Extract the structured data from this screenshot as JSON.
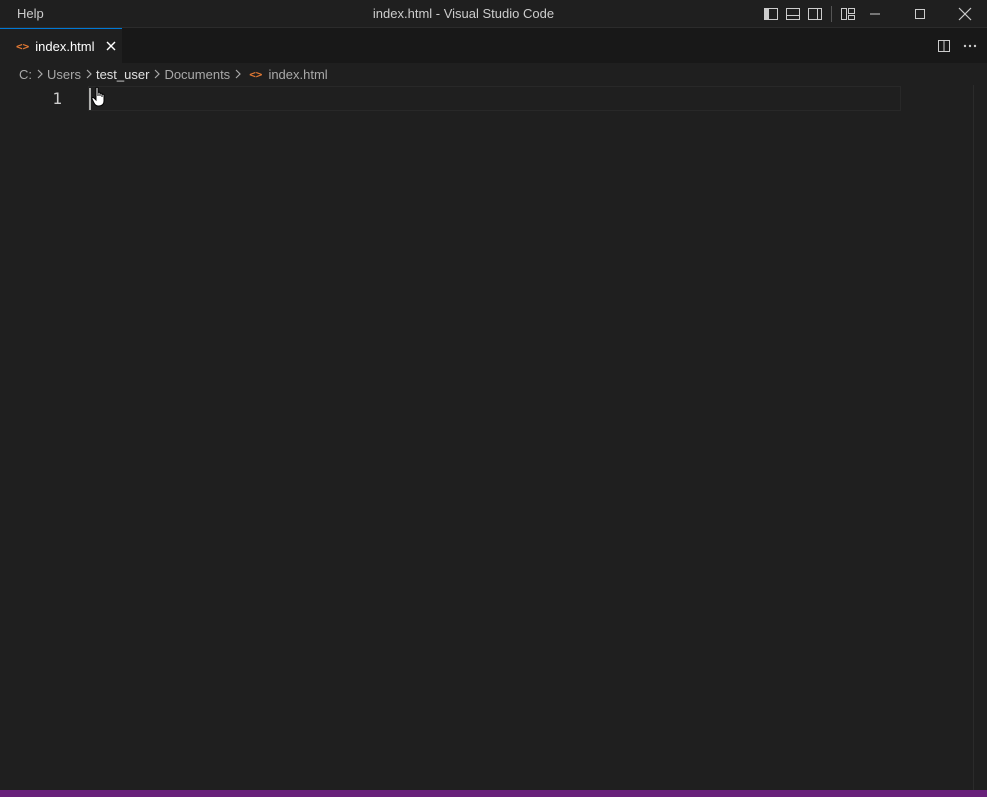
{
  "titlebar": {
    "menu_help": "Help",
    "window_title": "index.html - Visual Studio Code",
    "layout_icons": [
      "toggle-primary-sidebar-icon",
      "toggle-panel-icon",
      "toggle-secondary-sidebar-icon",
      "customize-layout-icon"
    ],
    "window_controls": [
      "minimize-icon",
      "maximize-icon",
      "close-icon"
    ]
  },
  "tabs": [
    {
      "label": "index.html",
      "icon": "html-file-icon",
      "active": true
    }
  ],
  "editor_actions": [
    "split-editor-icon",
    "more-actions-icon"
  ],
  "breadcrumb": {
    "items": [
      "C:",
      "Users",
      "test_user",
      "Documents",
      "index.html"
    ]
  },
  "editor": {
    "line_numbers": [
      "1"
    ],
    "content": ""
  },
  "colors": {
    "background": "#1f1f1f",
    "tabbar": "#181818",
    "html_icon": "#e37933",
    "statusbar": "#68217a",
    "active_tab_border": "#0078d4"
  }
}
